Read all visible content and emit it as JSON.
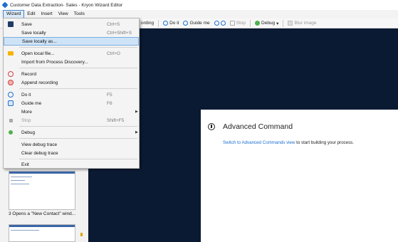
{
  "window": {
    "title": "Customer Data Extraction- Sales - Kryon Wizard Editor"
  },
  "menubar": {
    "items": [
      "Wizard",
      "Edit",
      "Insert",
      "View",
      "Tools"
    ]
  },
  "toolbar": {
    "recording_label": "ording",
    "do_it_label": "Do it",
    "guide_me_label": "Guide me",
    "stop_label": "Stop",
    "debug_label": "Debug",
    "blur_label": "Blur image"
  },
  "wizard_menu": {
    "save": {
      "label": "Save",
      "shortcut": "Ctrl+S"
    },
    "save_locally": {
      "label": "Save locally",
      "shortcut": "Ctrl+Shift+S"
    },
    "save_locally_as": {
      "label": "Save locally as..."
    },
    "open_local": {
      "label": "Open local file...",
      "shortcut": "Ctrl+O"
    },
    "import": {
      "label": "Import from Process Discovery..."
    },
    "record": {
      "label": "Record"
    },
    "append": {
      "label": "Append recording"
    },
    "do_it": {
      "label": "Do it",
      "shortcut": "F5"
    },
    "guide_me": {
      "label": "Guide me",
      "shortcut": "F6"
    },
    "more": {
      "label": "More"
    },
    "stop": {
      "label": "Stop",
      "shortcut": "Shift+F5"
    },
    "debug": {
      "label": "Debug"
    },
    "view_debug": {
      "label": "View debug trace"
    },
    "clear_debug": {
      "label": "Clear debug trace"
    },
    "exit": {
      "label": "Exit"
    }
  },
  "steps": {
    "step3_label": "3 Opens a \"New Contact\" wind..."
  },
  "advanced": {
    "title": "Advanced Command",
    "link": "Switch to Advanced Commands view",
    "rest": " to start building your process."
  }
}
